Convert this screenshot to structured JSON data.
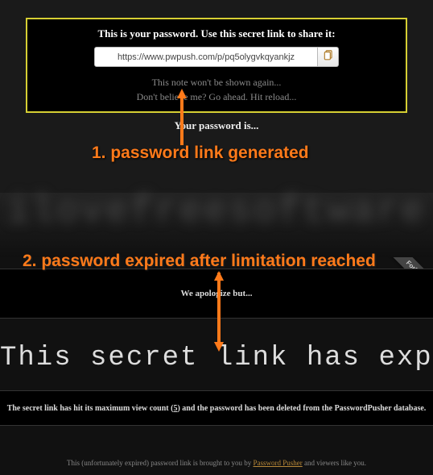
{
  "top": {
    "headline": "This is your password. Use this secret link to share it:",
    "url": "https://www.pwpush.com/p/pq5olygvkqyankjz",
    "note_line1": "This note won't be shown again...",
    "note_line2": "Don't believe me? Go ahead. Hit reload...",
    "your_password": "Your password is...",
    "blurred_password": "ilovefreesoftware"
  },
  "annotations": {
    "step1": "1. password link generated",
    "step2": "2. password expired after limitation reached",
    "arrow_color": "#ff7a1a"
  },
  "bottom": {
    "apology": "We apologize but...",
    "ribbon": "Fork me",
    "expired": "This secret link has expired.",
    "maxview_pre": "The secret link has hit its maximum view count (",
    "maxview_count": "5",
    "maxview_post": ") and the password has been deleted from the PasswordPusher database.",
    "brought_pre": "This (unfortunately expired) password link is brought to you by ",
    "brought_link": "Password Pusher",
    "brought_post": " and viewers like you."
  }
}
